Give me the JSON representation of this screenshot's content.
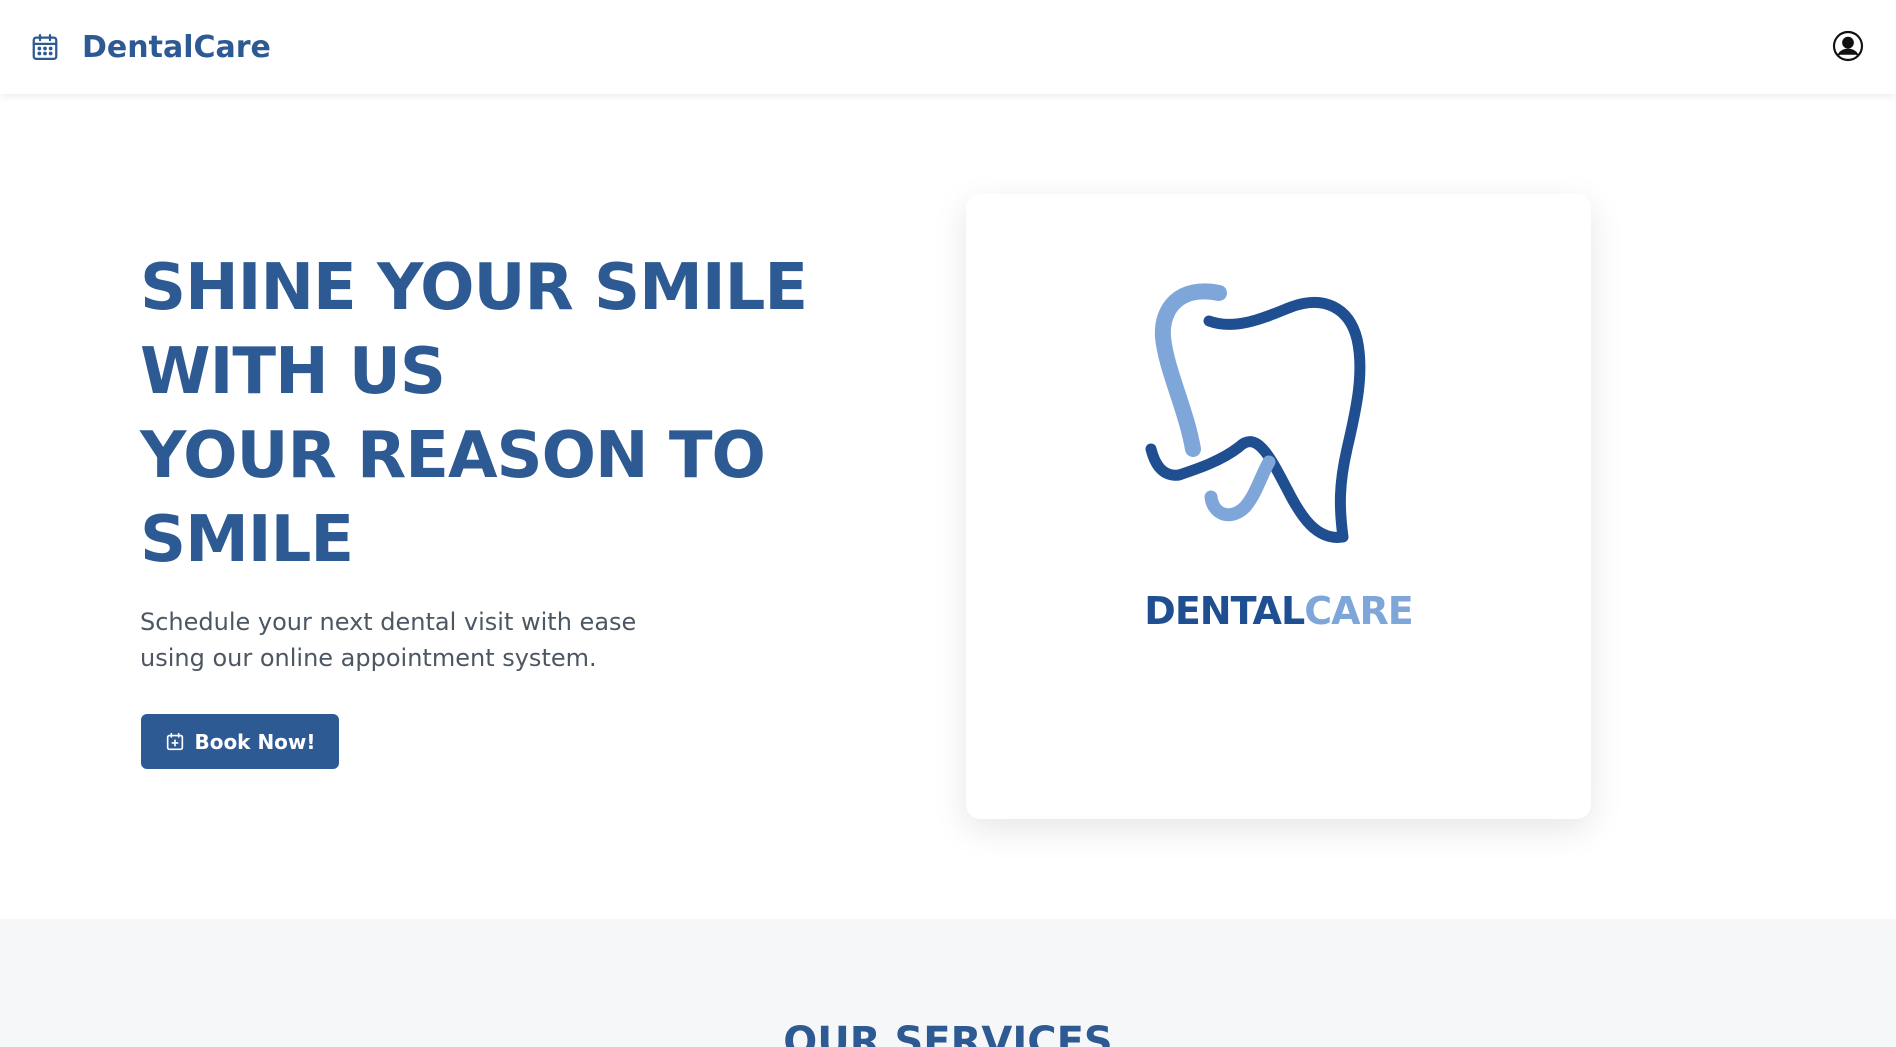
{
  "header": {
    "brand_name": "DentalCare",
    "brand_icon": "calendar-icon",
    "account_icon": "user-circle-icon"
  },
  "hero": {
    "headline_lines": [
      "SHINE YOUR SMILE",
      "WITH US",
      "YOUR REASON TO",
      "SMILE"
    ],
    "subtitle_line1": "Schedule your next dental visit with ease",
    "subtitle_line2": "using our online appointment system.",
    "cta_label": "Book Now!",
    "cta_icon": "calendar-plus-icon"
  },
  "logo": {
    "text_part1": "DENTAL",
    "text_part2": "CARE",
    "mark_icon": "tooth-icon"
  },
  "services": {
    "title": "OUR SERVICES"
  },
  "colors": {
    "primary": "#2e5a93",
    "logo_dark": "#1f4f91",
    "logo_light": "#7fa6d9",
    "body_text": "#4d5764",
    "section_bg": "#f6f7f9"
  }
}
